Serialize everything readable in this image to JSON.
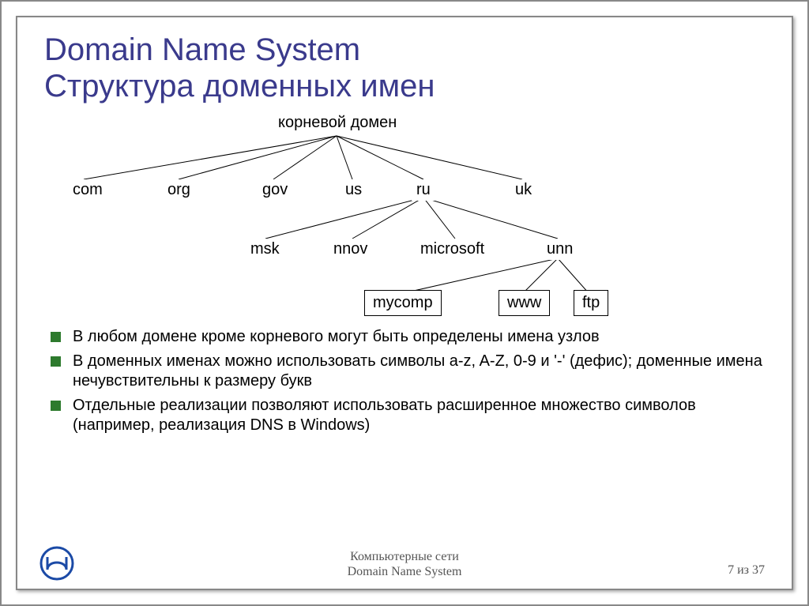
{
  "title_line1": "Domain Name System",
  "title_line2": "Структура доменных имен",
  "tree": {
    "root": "корневой домен",
    "level1": [
      "com",
      "org",
      "gov",
      "us",
      "ru",
      "uk"
    ],
    "ru_children": [
      "msk",
      "nnov",
      "microsoft",
      "unn"
    ],
    "unn_children": [
      "mycomp",
      "www",
      "ftp"
    ]
  },
  "bullets": [
    "В любом домене кроме корневого могут быть определены имена узлов",
    "В доменных именах можно использовать символы a-z, A-Z, 0-9 и '-' (дефис); доменные имена нечувствительны к размеру букв",
    "Отдельные реализации позволяют использовать расширенное множество символов (например, реализация DNS в Windows)"
  ],
  "footer": {
    "line1": "Компьютерные сети",
    "line2": "Domain Name System",
    "page": "7 из 37"
  }
}
